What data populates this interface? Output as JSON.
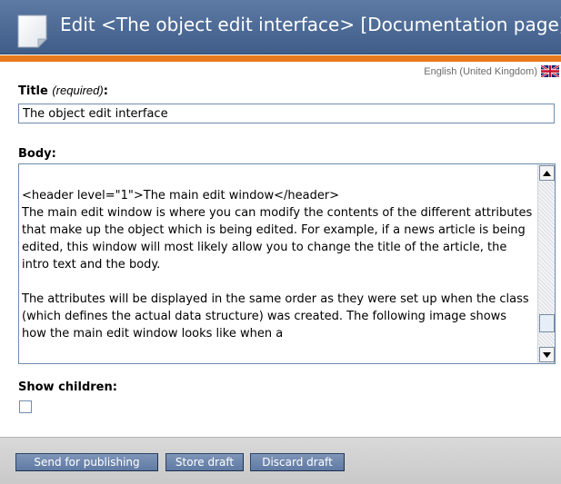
{
  "header": {
    "title": "Edit <The object edit interface> [Documentation page]",
    "page_icon": "document-icon",
    "language": "English (United Kingdom)",
    "language_flag": "uk-flag-icon"
  },
  "colors": {
    "header_blue": "#4a6893",
    "accent_orange": "#e87a1e",
    "button_blue": "#6f88b0"
  },
  "form": {
    "title_label": "Title",
    "title_required": "(required)",
    "title_colon": ":",
    "title_value": "The object edit interface",
    "body_label": "Body:",
    "body_value": "<header level=\"1\">The main edit window</header>\nThe main edit window is where you can modify the contents of the different attributes that make up the object which is being edited. For example, if a news article is being edited, this window will most likely allow you to change the title of the article, the intro text and the body.\n\nThe attributes will be displayed in the same order as they were set up when the class (which defines the actual data structure) was created. The following image shows how the main edit window looks like when a",
    "show_children_label": "Show children:",
    "show_children_checked": false
  },
  "actions": {
    "send_for_publishing": "Send for publishing",
    "store_draft": "Store draft",
    "discard_draft": "Discard draft"
  }
}
